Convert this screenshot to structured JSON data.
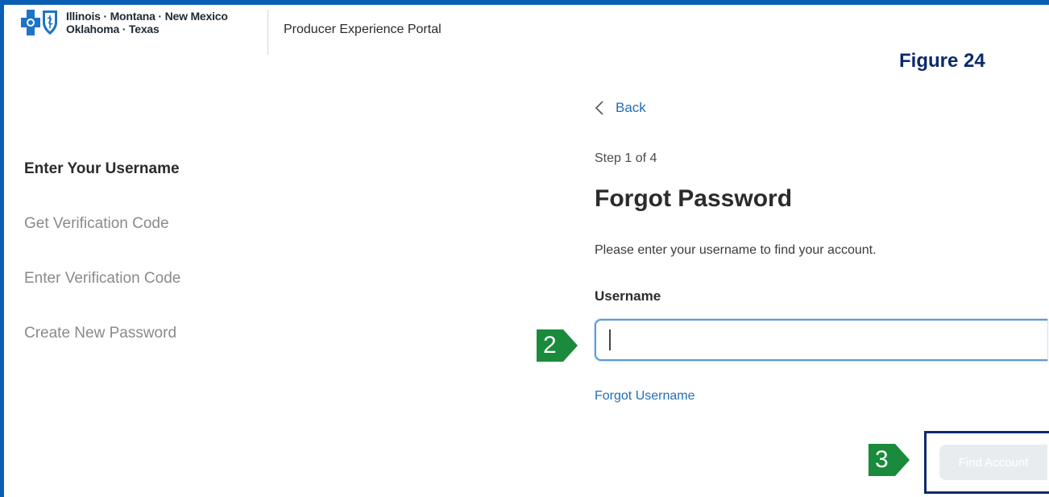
{
  "header": {
    "logo_line1": "Illinois · Montana · New Mexico",
    "logo_line2": "Oklahoma · Texas",
    "portal_title": "Producer Experience Portal"
  },
  "figure_label": "Figure 24",
  "steps": [
    {
      "label": "Enter Your Username",
      "active": true
    },
    {
      "label": "Get Verification Code",
      "active": false
    },
    {
      "label": "Enter Verification Code",
      "active": false
    },
    {
      "label": "Create New Password",
      "active": false
    }
  ],
  "form": {
    "back_label": "Back",
    "step_indicator": "Step 1 of 4",
    "heading": "Forgot Password",
    "instructions": "Please enter your username to find your account.",
    "username_label": "Username",
    "username_value": "",
    "forgot_username_link": "Forgot Username",
    "find_account_label": "Find Account"
  },
  "callouts": {
    "input_callout": "2",
    "button_callout": "3"
  },
  "colors": {
    "brand_blue": "#0a5fb4",
    "link_blue": "#1f6fb9",
    "callout_green": "#1a8a3c",
    "highlight_navy": "#0b2a6b"
  }
}
